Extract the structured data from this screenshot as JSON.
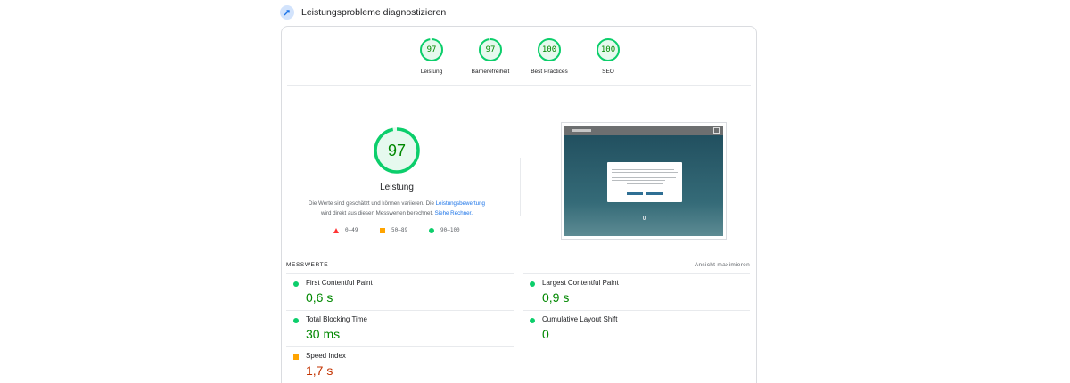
{
  "header": {
    "title": "Leistungsprobleme diagnostizieren",
    "icon": "pagespeed-icon"
  },
  "gauges": [
    {
      "value": "97",
      "label": "Leistung",
      "score": 0.97
    },
    {
      "value": "97",
      "label": "Barrierefreiheit",
      "score": 0.97
    },
    {
      "value": "100",
      "label": "Best Practices",
      "score": 1.0
    },
    {
      "value": "100",
      "label": "SEO",
      "score": 1.0
    }
  ],
  "performance": {
    "score": "97",
    "score_fraction": 0.97,
    "title": "Leistung",
    "desc_part1": "Die Werte sind geschätzt und können variieren. Die ",
    "desc_link1": "Leistungsbewertung",
    "desc_part2": "wird direkt aus diesen Messwerten berechnet. ",
    "desc_link2": "Siehe Rechner."
  },
  "legend": [
    {
      "range": "0–49",
      "shape": "triangle",
      "color": "#ff3333"
    },
    {
      "range": "50–89",
      "shape": "square",
      "color": "#ffa400"
    },
    {
      "range": "90–100",
      "shape": "circle",
      "color": "#0cce6b"
    }
  ],
  "metrics": {
    "title": "MESSWERTE",
    "toggle": "Ansicht maximieren",
    "items": [
      {
        "label": "First Contentful Paint",
        "value": "0,6 s",
        "status": "good"
      },
      {
        "label": "Largest Contentful Paint",
        "value": "0,9 s",
        "status": "good"
      },
      {
        "label": "Total Blocking Time",
        "value": "30 ms",
        "status": "good"
      },
      {
        "label": "Cumulative Layout Shift",
        "value": "0",
        "status": "good"
      },
      {
        "label": "Speed Index",
        "value": "1,7 s",
        "status": "average"
      }
    ]
  },
  "colors": {
    "good": "#0cce6b",
    "good_text": "#008800",
    "average": "#ffa400",
    "average_text": "#c33300",
    "link": "#1a73e8"
  }
}
